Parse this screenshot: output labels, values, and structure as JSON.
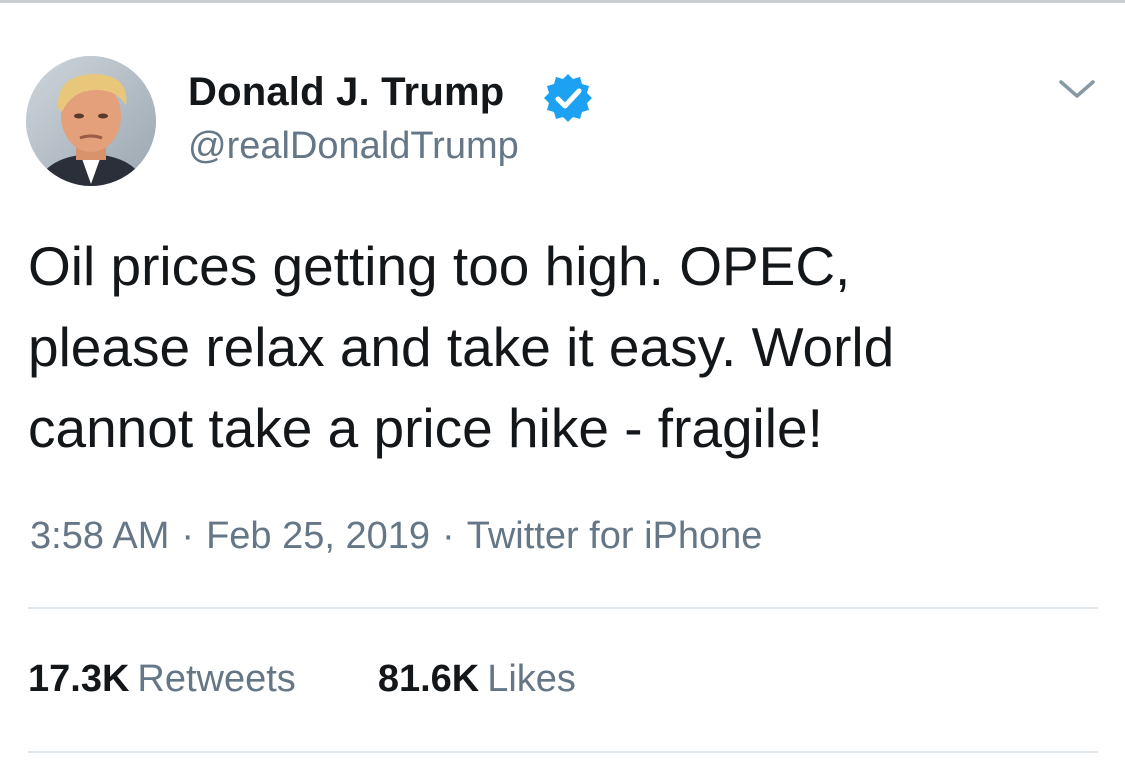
{
  "tweet": {
    "author": {
      "display_name": "Donald J. Trump",
      "handle": "@realDonaldTrump",
      "verified": true,
      "verified_color": "#1da1f2"
    },
    "text_lines": [
      "Oil prices getting too high. OPEC,",
      "please relax and take it easy. World",
      "cannot take a price hike - fragile!"
    ],
    "time": "3:58 AM",
    "date": "Feb 25, 2019",
    "source": "Twitter for iPhone",
    "separator": "·",
    "stats": {
      "retweets_count": "17.3K",
      "retweets_label": "Retweets",
      "likes_count": "81.6K",
      "likes_label": "Likes"
    }
  },
  "icons": {
    "verified": "verified-badge-icon",
    "more": "chevron-down-icon"
  },
  "colors": {
    "text_primary": "#14171a",
    "text_secondary": "#657786",
    "divider": "#e1e8ed"
  }
}
